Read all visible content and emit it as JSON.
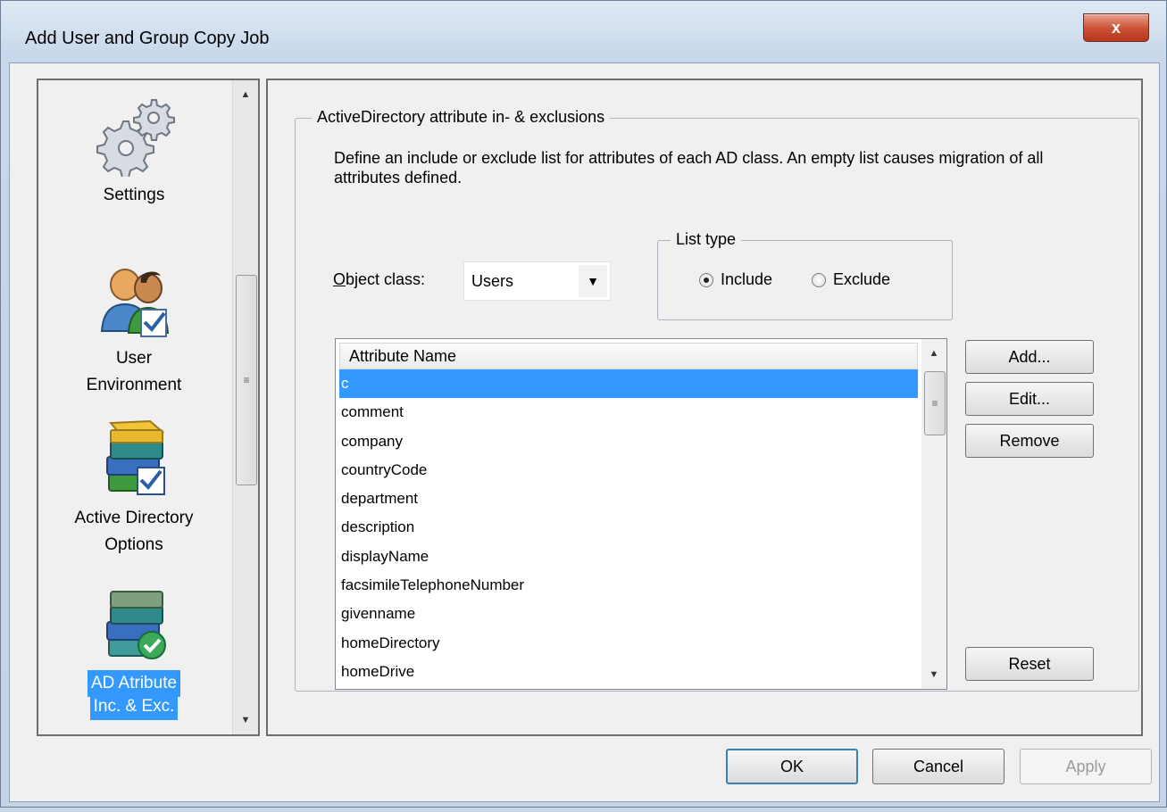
{
  "window": {
    "title": "Add User and Group Copy Job",
    "close_label": "x"
  },
  "sidebar": {
    "items": [
      {
        "label_lines": [
          "Settings"
        ],
        "icon": "gears-icon"
      },
      {
        "label_lines": [
          "User",
          "Environment"
        ],
        "icon": "users-icon"
      },
      {
        "label_lines": [
          "Active Directory",
          "Options"
        ],
        "icon": "books-check-icon"
      },
      {
        "label_lines": [
          "AD Atribute",
          "Inc. & Exc."
        ],
        "icon": "books-ok-icon",
        "selected": true
      }
    ]
  },
  "section": {
    "title": "ActiveDirectory attribute in- & exclusions",
    "description": "Define an include or exclude list for attributes of each AD class. An empty list causes migration of all attributes defined.",
    "object_class_label": "Object class:",
    "object_class_value": "Users",
    "list_type": {
      "title": "List type",
      "include_label": "Include",
      "exclude_label": "Exclude",
      "selected": "Include"
    }
  },
  "attributes": {
    "column_header": "Attribute Name",
    "rows": [
      "c",
      "comment",
      "company",
      "countryCode",
      "department",
      "description",
      "displayName",
      "facsimileTelephoneNumber",
      "givenname",
      "homeDirectory",
      "homeDrive"
    ],
    "selected_row": "c"
  },
  "buttons": {
    "add": "Add...",
    "edit": "Edit...",
    "remove": "Remove",
    "reset": "Reset",
    "ok": "OK",
    "cancel": "Cancel",
    "apply": "Apply"
  },
  "colors": {
    "selection": "#3399ff",
    "close_button": "#c94f33"
  }
}
